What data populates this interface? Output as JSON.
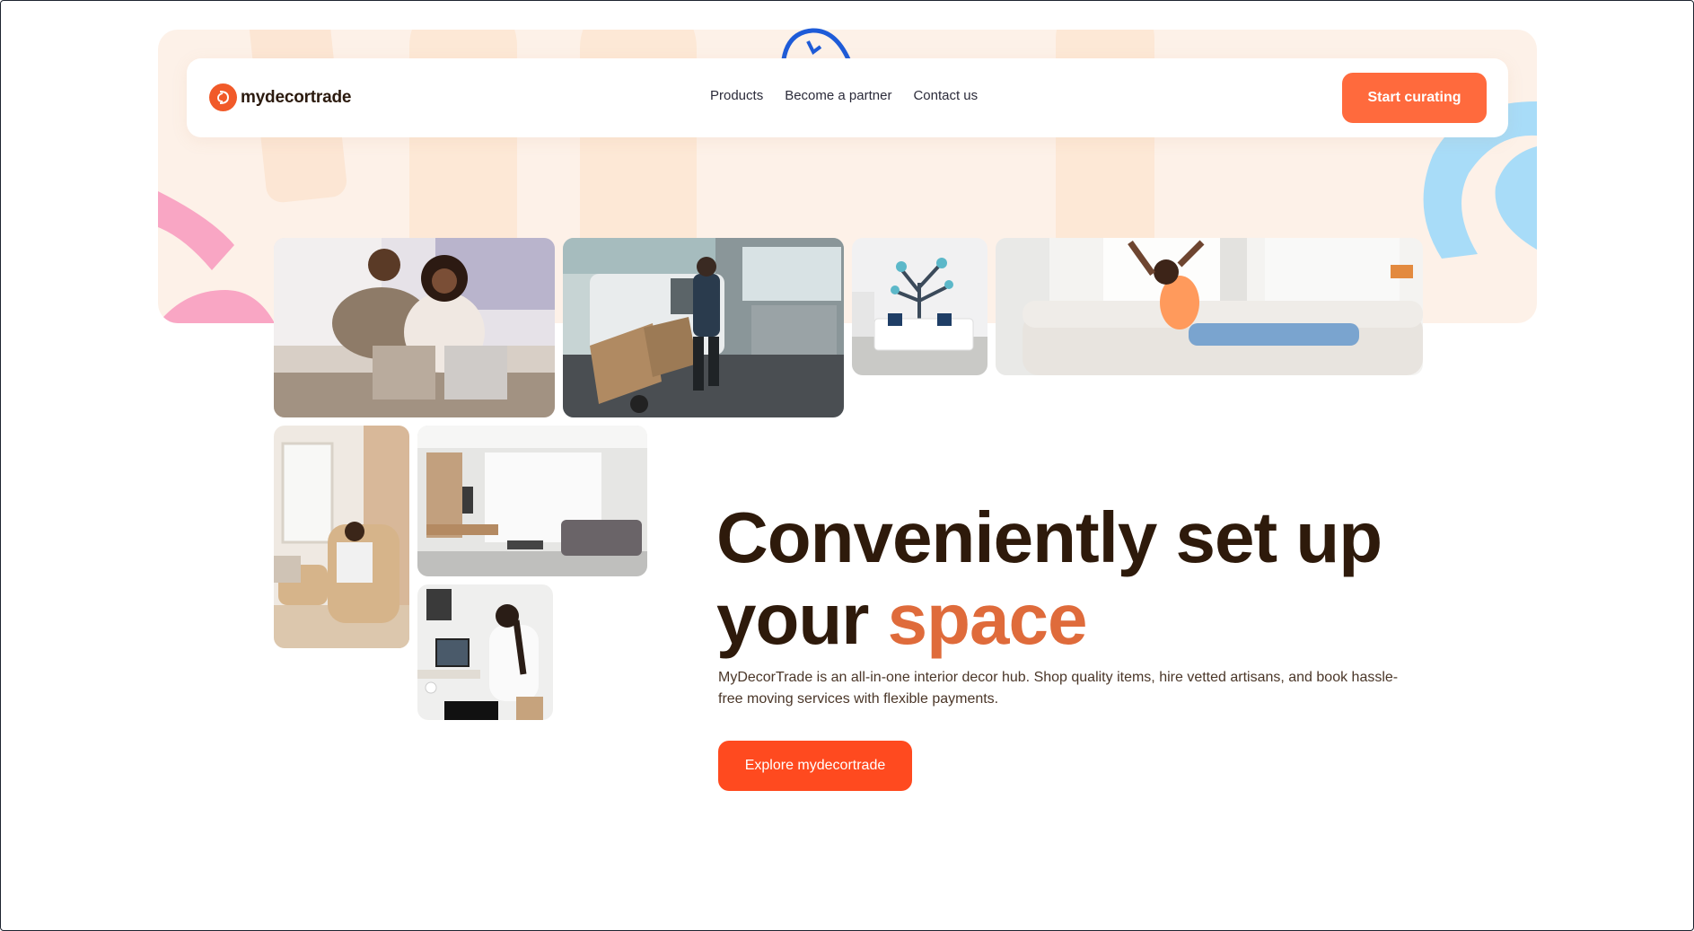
{
  "brand": {
    "name": "mydecortrade",
    "primary_color": "#f15a29",
    "cta_color": "#ff6a3d",
    "headline_accent_color": "#df6b3b"
  },
  "nav": {
    "links": [
      "Products",
      "Become a partner",
      "Contact us"
    ],
    "cta_label": "Start curating"
  },
  "hero": {
    "headline_line1": "Conveniently set up",
    "headline_line2_prefix": "your",
    "headline_accent": "space",
    "description": "MyDecorTrade is an all-in-one interior decor hub. Shop quality items, hire vetted artisans, and book hassle-free moving services with flexible payments.",
    "cta_label": "Explore mydecortrade"
  },
  "photos": [
    "couple-on-sofa-photo",
    "delivery-man-with-boxes-photo",
    "kids-room-tree-mural-photo",
    "woman-stretching-on-sofa-photo",
    "man-in-armchair-photo",
    "modern-living-room-photo",
    "woman-on-video-call-photo"
  ]
}
